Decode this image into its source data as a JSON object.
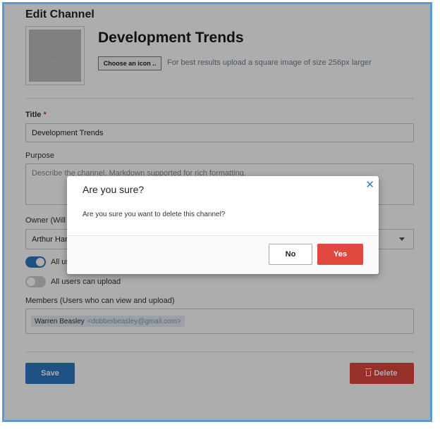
{
  "page": {
    "title": "Edit Channel",
    "icon_placeholder": "...",
    "channel_name": "Development Trends",
    "choose_icon_label": "Choose an icon ..",
    "icon_hint": "For best results upload a square image of size 256px larger"
  },
  "form": {
    "title_label": "Title",
    "required_mark": "*",
    "title_value": "Development Trends",
    "purpose_label": "Purpose",
    "purpose_placeholder": "Describe the channel. Markdown supported for rich formatting.",
    "owner_label": "Owner (Will u",
    "owner_value": "Arthur Hart",
    "toggle_view_label": "All us",
    "toggle_view_on": true,
    "toggle_upload_label": "All users can upload",
    "toggle_upload_on": false,
    "members_label": "Members (Users who can view and upload)",
    "members": [
      {
        "name": "Warren Beasley",
        "email": "<dobberbeasley@gmail.com>"
      }
    ]
  },
  "actions": {
    "save_label": "Save",
    "delete_label": "Delete"
  },
  "modal": {
    "title": "Are you sure?",
    "message": "Are you sure you want to delete this channel?",
    "close_glyph": "✕",
    "no_label": "No",
    "yes_label": "Yes"
  },
  "colors": {
    "primary": "#2d79c7",
    "danger": "#e0483e",
    "frame_border": "#5b9bd5"
  }
}
